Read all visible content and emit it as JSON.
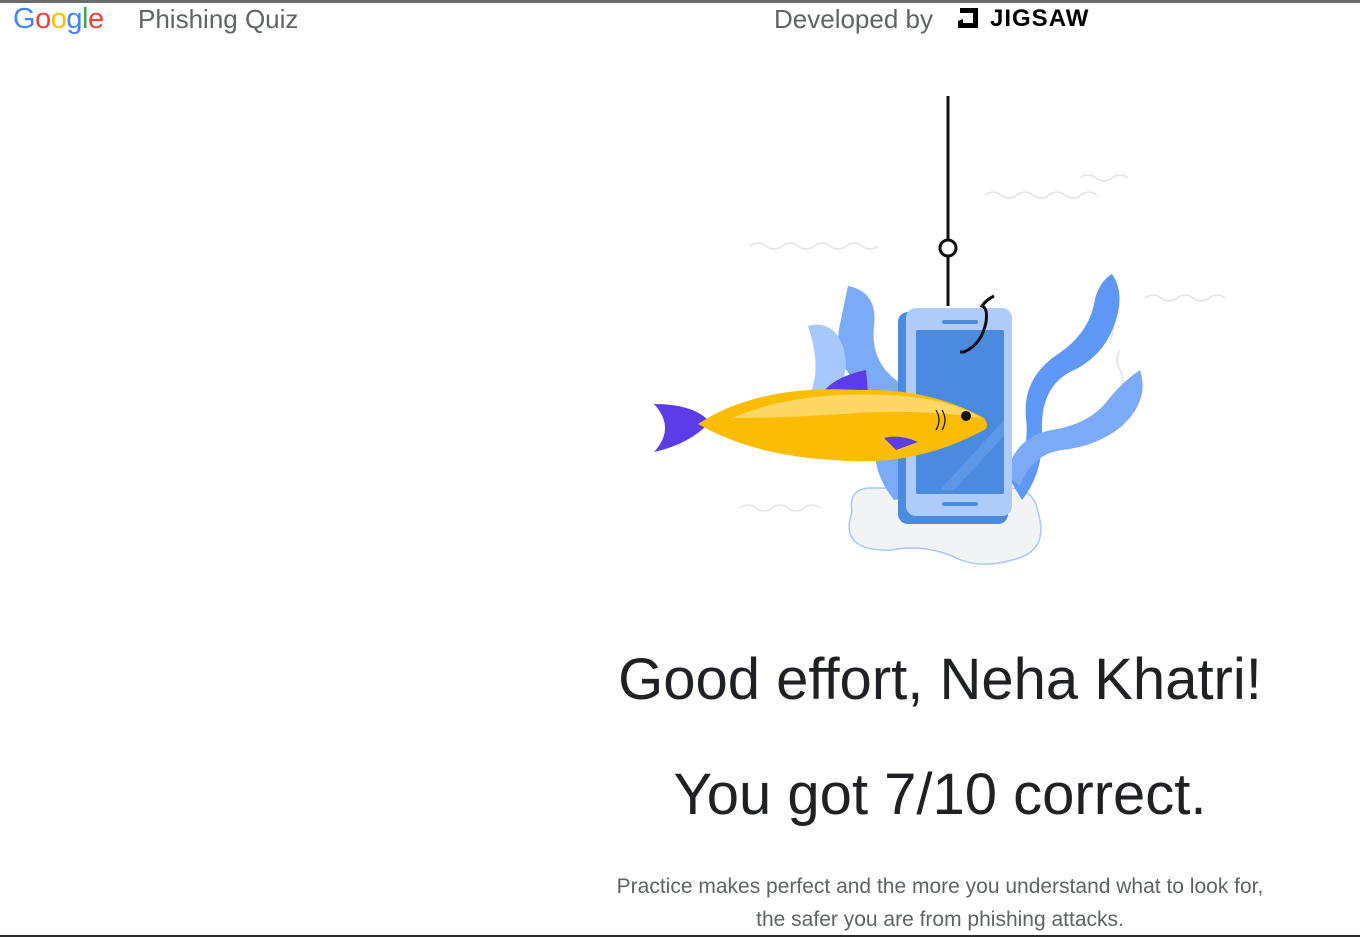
{
  "header": {
    "logo_text": "Google",
    "logo_letters": [
      "G",
      "o",
      "o",
      "g",
      "l",
      "e"
    ],
    "logo_colors": [
      "#4285F4",
      "#EA4335",
      "#FBBC05",
      "#4285F4",
      "#34A853",
      "#EA4335"
    ],
    "app_title": "Phishing Quiz",
    "developed_by_label": "Developed by",
    "partner_name": "JIGSAW"
  },
  "illustration": {
    "subject": "fish-on-hook-with-phone",
    "colors": {
      "fish_body": "#FBBC04",
      "fish_tail": "#5B3CE6",
      "phone_frame": "#AECBFA",
      "phone_screen": "#4A8BE0",
      "seaweed": "#5E97F6",
      "hook_line": "#111111"
    }
  },
  "result": {
    "heading": "Good effort, Neha Khatri!",
    "score_text": "You got 7/10 correct.",
    "score": {
      "correct": 7,
      "total": 10
    },
    "message_line1": "Practice makes perfect and the more you understand what to look for,",
    "message_line2": "the safer you are from phishing attacks."
  }
}
